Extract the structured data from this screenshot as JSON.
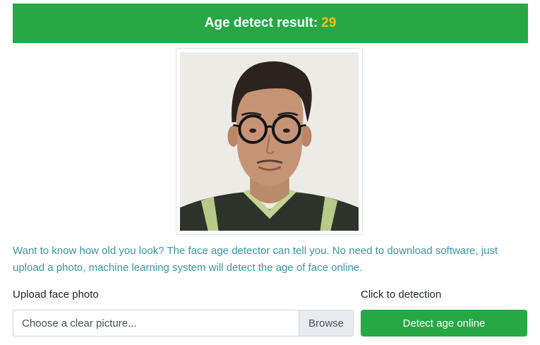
{
  "result": {
    "label": "Age detect result:",
    "value": "29",
    "banner_color": "#28a745",
    "value_color": "#ffc107"
  },
  "photo": {
    "alt": "face photo"
  },
  "description": "Want to know how old you look? The face age detector can tell you. No need to download software, just upload a photo, machine learning system will detect the age of face online.",
  "upload": {
    "label": "Upload face photo",
    "placeholder": "Choose a clear picture...",
    "browse_label": "Browse"
  },
  "detection": {
    "label": "Click to detection",
    "button_label": "Detect age online",
    "button_color": "#28a745"
  }
}
